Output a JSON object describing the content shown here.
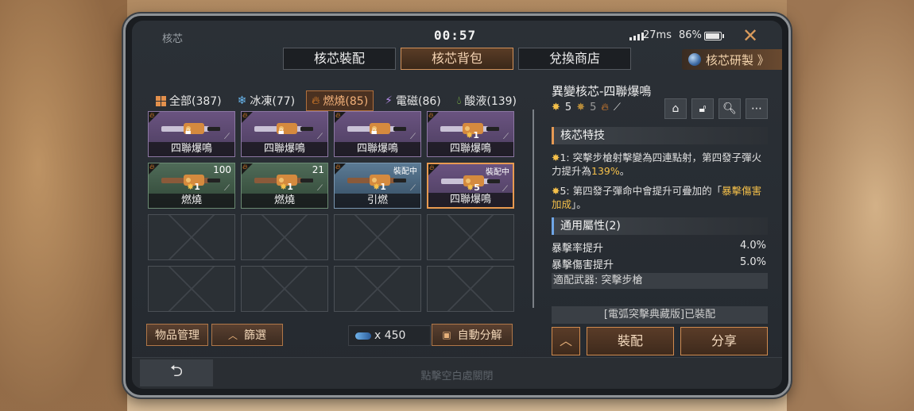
{
  "status": {
    "title": "核芯",
    "clock": "00:57",
    "ping": "27ms",
    "battery": "86%",
    "battery_level": 0.86
  },
  "tabs": [
    {
      "label": "核芯裝配",
      "active": false
    },
    {
      "label": "核芯背包",
      "active": true
    },
    {
      "label": "兌換商店",
      "active": false
    }
  ],
  "research": {
    "label": "核芯研製 》"
  },
  "filters": [
    {
      "label": "全部(387)",
      "icon": "grid-icon",
      "color": "#e3904c",
      "active": false
    },
    {
      "label": "冰凍(77)",
      "icon": "snowflake-icon",
      "color": "#6ab8f0",
      "active": false
    },
    {
      "label": "燃燒(85)",
      "icon": "fire-icon",
      "color": "#f08a2c",
      "active": true
    },
    {
      "label": "電磁(86)",
      "icon": "lightning-icon",
      "color": "#b48ae8",
      "active": false
    },
    {
      "label": "酸液(139)",
      "icon": "acid-drop-icon",
      "color": "#8fd14a",
      "active": false
    }
  ],
  "inventory": {
    "items": [
      {
        "name": "四聯爆鳴",
        "rarity": "purple",
        "locked": true
      },
      {
        "name": "四聯爆鳴",
        "rarity": "purple",
        "locked": true
      },
      {
        "name": "四聯爆鳴",
        "rarity": "purple",
        "locked": true
      },
      {
        "name": "四聯爆鳴",
        "rarity": "purple",
        "stars": "1"
      },
      {
        "name": "燃燒",
        "rarity": "green",
        "stars": "1",
        "qty": "100"
      },
      {
        "name": "燃燒",
        "rarity": "green",
        "stars": "1",
        "qty": "21"
      },
      {
        "name": "引燃",
        "rarity": "blue",
        "stars": "1",
        "tag": "裝配中"
      },
      {
        "name": "四聯爆鳴",
        "rarity": "purple",
        "stars": "5",
        "tag": "裝配中",
        "selected": true
      }
    ],
    "empty_slots": 8
  },
  "left_controls": {
    "manage_label": "物品管理",
    "filter_label": "篩選",
    "currency": "x 450",
    "auto_decompose_label": "自動分解"
  },
  "detail": {
    "title": "異變核芯-四聯爆鳴",
    "star_level": "5",
    "star_level_grey": "5",
    "skill_header": "核芯特技",
    "skills": [
      {
        "level": "1:",
        "text_a": " 突擊步槍射擊變為四連點射，第四發子彈火力提升為",
        "highlight": "139%",
        "text_b": "。"
      },
      {
        "level": "5:",
        "text_a": " 第四發子彈命中會提升可疊加的「",
        "highlight": "暴擊傷害加成",
        "text_b": "」。"
      }
    ],
    "attr_header": "通用屬性(2)",
    "stats": [
      {
        "label": "暴擊率提升",
        "value": "4.0%"
      },
      {
        "label": "暴擊傷害提升",
        "value": "5.0%"
      }
    ],
    "weapon": "適配武器: 突擊步槍",
    "equipped_on": "[電弧突擊典藏版]已裝配",
    "equip_label": "裝配",
    "share_label": "分享"
  },
  "footer": {
    "hint": "點擊空白處關閉"
  },
  "colors": {
    "accent": "#d3925a",
    "star": "#f5c04a"
  }
}
